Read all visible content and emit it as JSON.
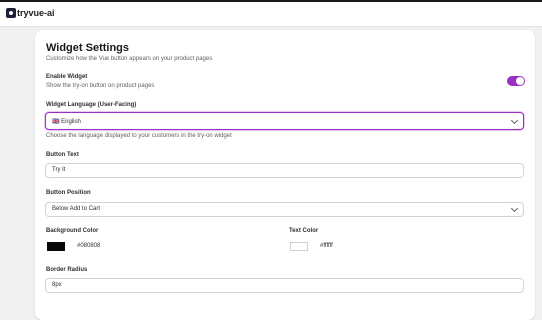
{
  "app": {
    "brand": "tryvue-ai"
  },
  "settings": {
    "title": "Widget Settings",
    "subtitle": "Customize how the Vue button appears on your product pages",
    "enable_widget": {
      "label": "Enable Widget",
      "help": "Show the try-on button on product pages",
      "enabled": true
    },
    "language": {
      "label": "Widget Language (User-Facing)",
      "value": "🇬🇧 English",
      "help": "Choose the language displayed to your customers in the try-on widget"
    },
    "button_text": {
      "label": "Button Text",
      "value": "Try It"
    },
    "button_position": {
      "label": "Button Position",
      "value": "Below Add to Cart"
    },
    "background_color": {
      "label": "Background Color",
      "value": "#080808",
      "swatch": "#080808"
    },
    "text_color": {
      "label": "Text Color",
      "value": "#ffffff",
      "swatch": "#ffffff"
    },
    "border_radius": {
      "label": "Border Radius",
      "value": "8px"
    }
  },
  "colors": {
    "accent": "#9b2fc4"
  }
}
